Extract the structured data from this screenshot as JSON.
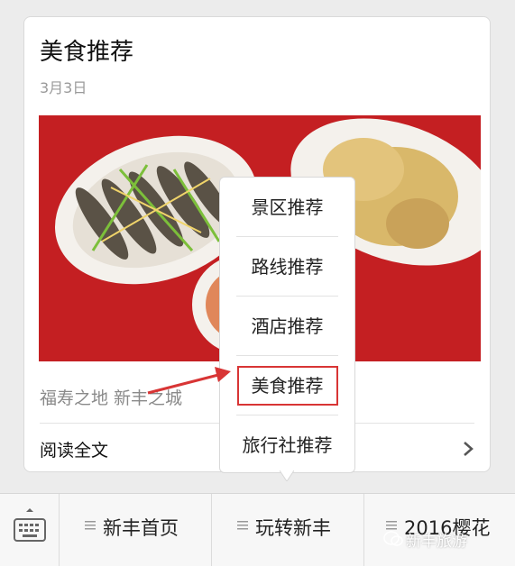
{
  "article": {
    "title": "美食推荐",
    "date": "3月3日",
    "caption": "福寿之地 新丰之城",
    "read_more": "阅读全文"
  },
  "menu": {
    "items": [
      {
        "label": "景区推荐"
      },
      {
        "label": "路线推荐"
      },
      {
        "label": "酒店推荐"
      },
      {
        "label": "美食推荐"
      },
      {
        "label": "旅行社推荐"
      }
    ],
    "highlighted_index": 3
  },
  "tabbar": {
    "tabs": [
      {
        "label": "新丰首页"
      },
      {
        "label": "玩转新丰"
      },
      {
        "label": "2016樱花"
      }
    ]
  },
  "watermark": {
    "text": "新丰旅游"
  },
  "colors": {
    "highlight": "#d83535",
    "photo_bg": "#c41f22"
  }
}
